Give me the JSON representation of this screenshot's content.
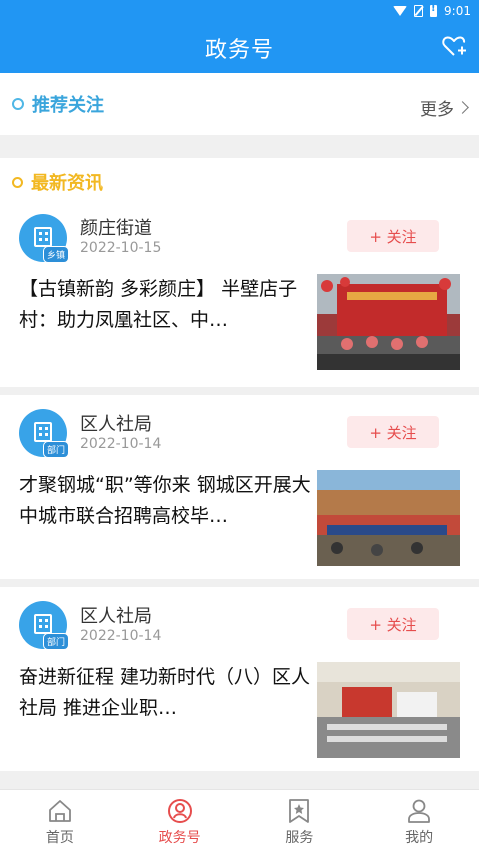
{
  "status": {
    "time": "9:01"
  },
  "header": {
    "title": "政务号"
  },
  "recommend": {
    "label": "推荐关注",
    "more": "更多"
  },
  "news": {
    "label": "最新资讯"
  },
  "follow_label": "+ 关注",
  "articles": [
    {
      "source": "颜庄街道",
      "badge": "乡镇",
      "date": "2022-10-15",
      "title": "【古镇新韵 多彩颜庄】 半壁店子村：助力凤凰社区、中…"
    },
    {
      "source": "区人社局",
      "badge": "部门",
      "date": "2022-10-14",
      "title": "才聚钢城“职”等你来 钢城区开展大中城市联合招聘高校毕…"
    },
    {
      "source": "区人社局",
      "badge": "部门",
      "date": "2022-10-14",
      "title": "奋进新征程  建功新时代（八）区人社局 推进企业职…"
    }
  ],
  "nav": [
    {
      "label": "首页",
      "icon": "home-icon",
      "active": false
    },
    {
      "label": "政务号",
      "icon": "gov-account-icon",
      "active": true
    },
    {
      "label": "服务",
      "icon": "star-bookmark-icon",
      "active": false
    },
    {
      "label": "我的",
      "icon": "user-icon",
      "active": false
    }
  ],
  "colors": {
    "primary": "#2196f3",
    "accent_red": "#e64d4d",
    "recommend_blue": "#3aa5dc",
    "news_orange": "#f2b822"
  }
}
